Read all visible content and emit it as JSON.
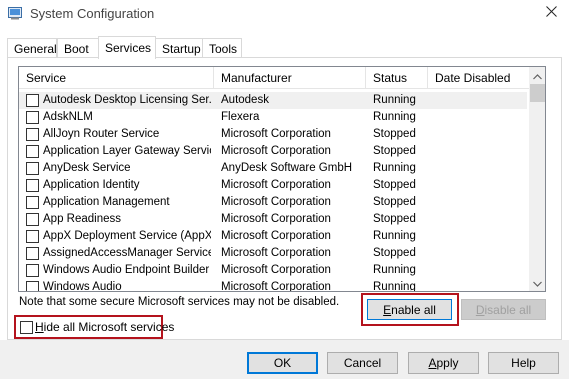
{
  "window": {
    "title": "System Configuration"
  },
  "tabs": [
    {
      "label": "General"
    },
    {
      "label": "Boot"
    },
    {
      "label": "Services"
    },
    {
      "label": "Startup"
    },
    {
      "label": "Tools"
    }
  ],
  "active_tab": "Services",
  "services_list": {
    "columns": [
      "Service",
      "Manufacturer",
      "Status",
      "Date Disabled"
    ],
    "rows": [
      {
        "service": "Autodesk Desktop Licensing Ser...",
        "manufacturer": "Autodesk",
        "status": "Running",
        "date_disabled": "",
        "checked": false,
        "selected": true
      },
      {
        "service": "AdskNLM",
        "manufacturer": "Flexera",
        "status": "Running",
        "date_disabled": "",
        "checked": false,
        "selected": false
      },
      {
        "service": "AllJoyn Router Service",
        "manufacturer": "Microsoft Corporation",
        "status": "Stopped",
        "date_disabled": "",
        "checked": false,
        "selected": false
      },
      {
        "service": "Application Layer Gateway Service",
        "manufacturer": "Microsoft Corporation",
        "status": "Stopped",
        "date_disabled": "",
        "checked": false,
        "selected": false
      },
      {
        "service": "AnyDesk Service",
        "manufacturer": "AnyDesk Software GmbH",
        "status": "Running",
        "date_disabled": "",
        "checked": false,
        "selected": false
      },
      {
        "service": "Application Identity",
        "manufacturer": "Microsoft Corporation",
        "status": "Stopped",
        "date_disabled": "",
        "checked": false,
        "selected": false
      },
      {
        "service": "Application Management",
        "manufacturer": "Microsoft Corporation",
        "status": "Stopped",
        "date_disabled": "",
        "checked": false,
        "selected": false
      },
      {
        "service": "App Readiness",
        "manufacturer": "Microsoft Corporation",
        "status": "Stopped",
        "date_disabled": "",
        "checked": false,
        "selected": false
      },
      {
        "service": "AppX Deployment Service (AppX...",
        "manufacturer": "Microsoft Corporation",
        "status": "Running",
        "date_disabled": "",
        "checked": false,
        "selected": false
      },
      {
        "service": "AssignedAccessManager Service",
        "manufacturer": "Microsoft Corporation",
        "status": "Stopped",
        "date_disabled": "",
        "checked": false,
        "selected": false
      },
      {
        "service": "Windows Audio Endpoint Builder",
        "manufacturer": "Microsoft Corporation",
        "status": "Running",
        "date_disabled": "",
        "checked": false,
        "selected": false
      },
      {
        "service": "Windows Audio",
        "manufacturer": "Microsoft Corporation",
        "status": "Running",
        "date_disabled": "",
        "checked": false,
        "selected": false
      }
    ]
  },
  "note": "Note that some secure Microsoft services may not be disabled.",
  "enable_all": {
    "pre": "",
    "accel": "E",
    "post": "nable all"
  },
  "disable_all": {
    "pre": "",
    "accel": "D",
    "post": "isable all"
  },
  "hide_ms": {
    "pre": "",
    "accel": "H",
    "post": "ide all Microsoft services",
    "checked": false
  },
  "footer_buttons": {
    "ok": "OK",
    "cancel": "Cancel",
    "apply": {
      "pre": "",
      "accel": "A",
      "post": "pply"
    },
    "help": "Help"
  },
  "colors": {
    "highlight_box": "#b4131d",
    "focus_blue": "#0078d7"
  },
  "icons": {
    "app": "msconfig-icon",
    "close": "close-icon",
    "scroll_up": "chevron-up-icon",
    "scroll_down": "chevron-down-icon"
  }
}
